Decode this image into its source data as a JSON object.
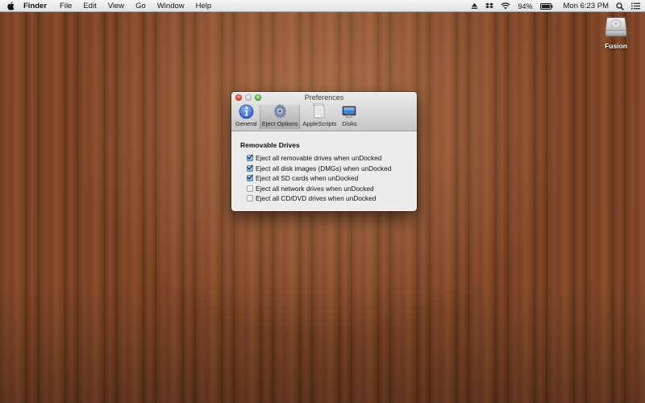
{
  "menubar": {
    "app_name": "Finder",
    "menus": [
      "File",
      "Edit",
      "View",
      "Go",
      "Window",
      "Help"
    ],
    "battery_percent": "94%",
    "clock": "Mon 6:23 PM",
    "status_icons": [
      "eject-icon",
      "dropbox-icon",
      "wifi-icon",
      "battery-icon",
      "search-icon",
      "list-icon"
    ]
  },
  "desktop": {
    "icons": [
      {
        "label": "Fusion",
        "icon": "hard-drive-icon"
      }
    ]
  },
  "window": {
    "title": "Preferences",
    "toolbar": [
      {
        "label": "General",
        "icon": "info-icon",
        "selected": false
      },
      {
        "label": "Eject Options",
        "icon": "gear-icon",
        "selected": true
      },
      {
        "label": "AppleScripts",
        "icon": "script-icon",
        "selected": false
      },
      {
        "label": "Disks",
        "icon": "display-icon",
        "selected": false
      }
    ],
    "section_title": "Removable Drives",
    "options": [
      {
        "label": "Eject all removable drives when unDocked",
        "checked": true
      },
      {
        "label": "Eject all disk images (DMGs) when unDocked",
        "checked": true
      },
      {
        "label": "Eject all SD cards when unDocked",
        "checked": true
      },
      {
        "label": "Eject all network drives when unDocked",
        "checked": false
      },
      {
        "label": "Eject all CD/DVD drives when unDocked",
        "checked": false
      }
    ]
  },
  "colors": {
    "wood_base": "#7a4526",
    "selection_blue": "#6fa6de",
    "close_red": "#e0443a",
    "zoom_green": "#56b83a"
  }
}
